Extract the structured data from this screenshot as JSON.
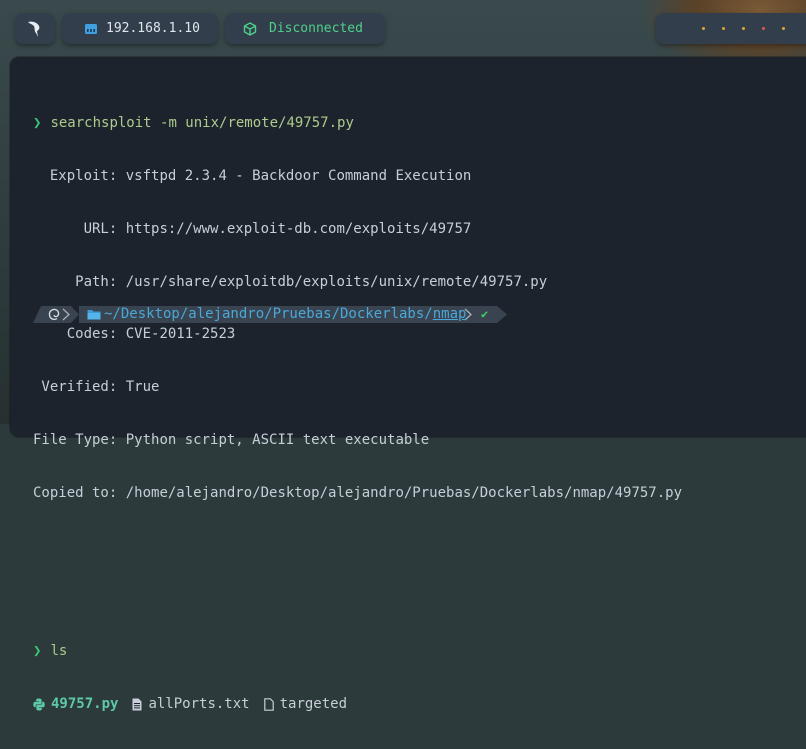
{
  "topbar": {
    "logo_icon": "kali-dragon-icon",
    "ip_icon": "ethernet-icon",
    "ip_address": "192.168.1.10",
    "vpn_icon": "cube-icon",
    "vpn_status": "Disconnected",
    "workspace_dots": [
      "#e0a33a",
      "#e0a33a",
      "#e0a33a",
      "#e05a4a",
      "#e0a33a"
    ]
  },
  "terminal": {
    "prompt_symbol": "❯",
    "command1": "searchsploit -m unix/remote/49757.py",
    "output": [
      {
        "label": "  Exploit:",
        "value": " vsftpd 2.3.4 - Backdoor Command Execution"
      },
      {
        "label": "      URL:",
        "value": " https://www.exploit-db.com/exploits/49757"
      },
      {
        "label": "     Path:",
        "value": " /usr/share/exploitdb/exploits/unix/remote/49757.py"
      },
      {
        "label": "    Codes:",
        "value": " CVE-2011-2523"
      },
      {
        "label": " Verified:",
        "value": " True"
      },
      {
        "label": "File Type:",
        "value": " Python script, ASCII text executable"
      },
      {
        "label": "Copied to:",
        "value": " /home/alejandro/Desktop/alejandro/Pruebas/Dockerlabs/nmap/49757.py"
      }
    ],
    "command2": "ls",
    "ls_files": [
      {
        "name": "49757.py",
        "icon": "python-icon"
      },
      {
        "name": "allPorts.txt",
        "icon": "text-file-icon"
      },
      {
        "name": "targeted",
        "icon": "file-icon"
      }
    ],
    "ps1_path": "~/Desktop/alejandro/Pruebas/Dockerlabs/",
    "ps1_dir": "nmap",
    "ps1_status": "✔"
  }
}
